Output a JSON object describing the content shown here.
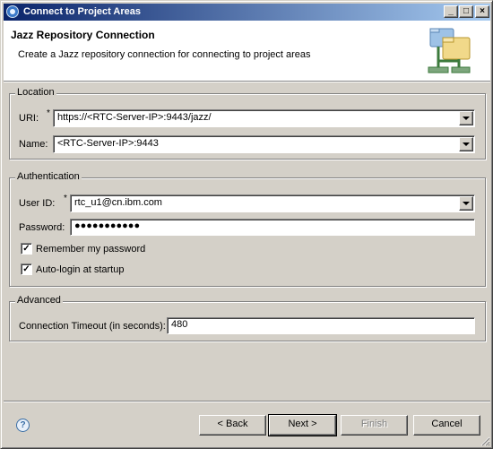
{
  "window": {
    "title": "Connect to Project Areas"
  },
  "banner": {
    "title": "Jazz Repository Connection",
    "description": "Create a Jazz repository connection for connecting to project areas"
  },
  "location": {
    "group_label": "Location",
    "uri_label": "URI:",
    "uri_value": "https://<RTC-Server-IP>:9443/jazz/",
    "name_label": "Name:",
    "name_value": "<RTC-Server-IP>:9443"
  },
  "authentication": {
    "group_label": "Authentication",
    "userid_label": "User ID:",
    "userid_value": "rtc_u1@cn.ibm.com",
    "password_label": "Password:",
    "password_masked": "●●●●●●●●●●●",
    "remember_label": "Remember my password",
    "remember_checked": true,
    "autologin_label": "Auto-login at startup",
    "autologin_checked": true
  },
  "advanced": {
    "group_label": "Advanced",
    "timeout_label": "Connection Timeout (in seconds):",
    "timeout_value": "480"
  },
  "buttons": {
    "back": "< Back",
    "next": "Next >",
    "finish": "Finish",
    "cancel": "Cancel"
  },
  "required_marker": "*",
  "icons": {
    "app": "jazz-icon",
    "help": "help-icon",
    "banner": "repository-connection-icon"
  },
  "colors": {
    "titlebar_start": "#0a246a",
    "titlebar_end": "#a6caf0",
    "dialog_bg": "#d4d0c8"
  }
}
